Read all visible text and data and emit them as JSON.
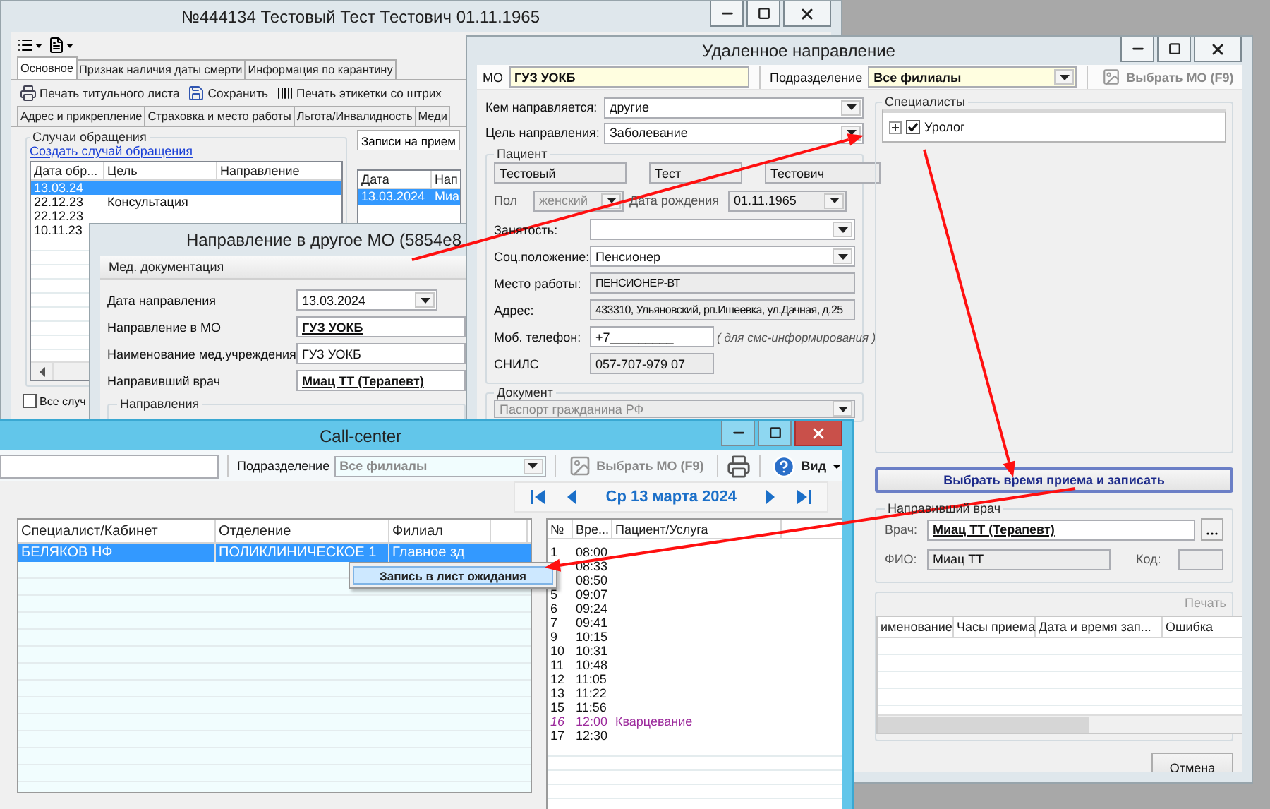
{
  "patient_window": {
    "title": "№444134 Тестовый Тест Тестович 01.11.1965",
    "tabs": [
      {
        "label": "Основное",
        "selected": true
      },
      {
        "label": "Признак наличия даты смерти",
        "selected": false
      },
      {
        "label": "Информация по карантину",
        "selected": false
      }
    ],
    "toolbar": [
      {
        "kind": "print",
        "label": "Печать титульного листа"
      },
      {
        "kind": "save",
        "label": "Сохранить"
      },
      {
        "kind": "barcode",
        "label": "Печать этикетки со штрих"
      }
    ],
    "subtabs": [
      {
        "label": "Адрес и прикрепление",
        "selected": false
      },
      {
        "label": "Страховка и место работы",
        "selected": false
      },
      {
        "label": "Льгота/Инвалидность",
        "selected": false
      },
      {
        "label": "Меди",
        "selected": false
      }
    ],
    "cases": {
      "title": "Случаи обращения",
      "link": "Создать случай обращения",
      "columns": [
        "Дата обр...",
        "Цель",
        "Направление"
      ],
      "rows": [
        {
          "date": "13.03.24",
          "selected": true
        },
        {
          "date": "22.12.23",
          "goal": "Консультация",
          "selected": false
        },
        {
          "date": "22.12.23",
          "selected": false
        },
        {
          "date": "10.11.23",
          "selected": false
        }
      ]
    },
    "show_all": {
      "label": "Все случ",
      "checked": false
    },
    "appointments": {
      "tab": "Записи на прием",
      "columns": [
        "Дата",
        "Нап"
      ],
      "rows": [
        {
          "date": "13.03.2024",
          "column_2": "Миа",
          "selected": true
        }
      ]
    }
  },
  "referral_window": {
    "title": "Направление в другое МО (5854e8",
    "section": "Мед. документация",
    "fields": [
      {
        "kind": "date",
        "label": "Дата направления",
        "value": "13.03.2024"
      },
      {
        "kind": "lookup",
        "label": "Направление в МО",
        "value": "ГУЗ УОКБ"
      },
      {
        "kind": "text",
        "label": "Наименование мед.учреждения",
        "value": "ГУЗ УОКБ"
      },
      {
        "kind": "lookup",
        "label": "Направивший врач",
        "value": "Миац ТТ (Терапевт)"
      }
    ],
    "group": "Направления"
  },
  "remote_window": {
    "title": "Удаленное направление",
    "mo_label": "МО",
    "mo_value": "ГУЗ УОКБ",
    "division_label": "Подразделение",
    "division_value": "Все филиалы",
    "choose_mo": {
      "label": "Выбрать МО (F9)",
      "disabled": true
    },
    "referral_fields": [
      {
        "label": "Кем направляется:",
        "value": "другие"
      },
      {
        "label": "Цель направления:",
        "value": "Заболевание"
      }
    ],
    "patient": {
      "title": "Пациент",
      "last_name": "Тестовый",
      "first_name": "Тест",
      "middle_name": "Тестович",
      "sex_label": "Пол",
      "sex": "женский",
      "birth_label": "Дата рождения",
      "birth_date": "01.11.1965",
      "fields": [
        {
          "kind": "dropdown",
          "label": "Занятость:"
        },
        {
          "kind": "dropdown",
          "label": "Соц.положение:",
          "value": "Пенсионер"
        },
        {
          "kind": "readonly",
          "label": "Место работы:",
          "value": "ПЕНСИОНЕР-ВТ"
        },
        {
          "kind": "readonly",
          "label": "Адрес:",
          "value": "433310, Ульяновский, рп.Ишеевка, ул.Дачная, д.25"
        },
        {
          "kind": "phone",
          "label": "Моб. телефон:",
          "value": "+7_________",
          "hint": "( для смс-информирования )"
        },
        {
          "kind": "short",
          "label": "СНИЛС",
          "value": "057-707-979 07"
        }
      ]
    },
    "document": {
      "title": "Документ",
      "value": "Паспорт гражданина РФ",
      "disabled": true
    },
    "specialists": {
      "title": "Специалисты",
      "items": [
        {
          "label": "Уролог",
          "checked": true
        }
      ]
    },
    "schedule_button": "Выбрать время приема и записать",
    "doctor": {
      "title": "Направивший врач",
      "doctor_label": "Врач:",
      "doctor_value": "Миац ТТ (Терапевт)",
      "name_label": "ФИО:",
      "name_value": "Миац ТТ",
      "code_label": "Код:"
    },
    "results": {
      "print": "Печать",
      "columns": [
        "именование",
        "Часы приема",
        "Дата и время зап...",
        "Ошибка"
      ]
    },
    "cancel": "Отмена"
  },
  "callcenter_window": {
    "title": "Call-center",
    "division_label": "Подразделение",
    "division_value": "Все филиалы",
    "choose_mo": {
      "label": "Выбрать МО (F9)",
      "disabled": true
    },
    "view_menu": "Вид",
    "date": "Ср 13 марта 2024",
    "specialists": {
      "columns": [
        "Специалист/Кабинет",
        "Отделение",
        "Филиал"
      ],
      "rows": [
        {
          "specialist": "БЕЛЯКОВ НФ",
          "department": "ПОЛИКЛИНИЧЕСКОЕ 1",
          "branch": "Главное зд",
          "selected": true
        }
      ]
    },
    "context_menu": [
      "Запись в лист ожидания"
    ],
    "slots": {
      "columns": [
        "№",
        "Вре...",
        "Пациент/Услуга"
      ],
      "rows": [
        {
          "kind": "free",
          "num": "1",
          "time": "08:00"
        },
        {
          "kind": "free",
          "time": "08:33"
        },
        {
          "kind": "free",
          "time": "08:50"
        },
        {
          "kind": "free",
          "num": "5",
          "time": "09:07"
        },
        {
          "kind": "free",
          "num": "6",
          "time": "09:24"
        },
        {
          "kind": "free",
          "num": "7",
          "time": "09:41"
        },
        {
          "kind": "free",
          "num": "9",
          "time": "10:15"
        },
        {
          "kind": "free",
          "num": "10",
          "time": "10:31"
        },
        {
          "kind": "free",
          "num": "11",
          "time": "10:48"
        },
        {
          "kind": "free",
          "num": "12",
          "time": "11:05"
        },
        {
          "kind": "free",
          "num": "13",
          "time": "11:22"
        },
        {
          "kind": "free",
          "num": "15",
          "time": "11:56"
        },
        {
          "kind": "service",
          "num": "16",
          "time": "12:00",
          "service": "Кварцевание"
        },
        {
          "kind": "free",
          "num": "17",
          "time": "12:30"
        }
      ]
    }
  }
}
